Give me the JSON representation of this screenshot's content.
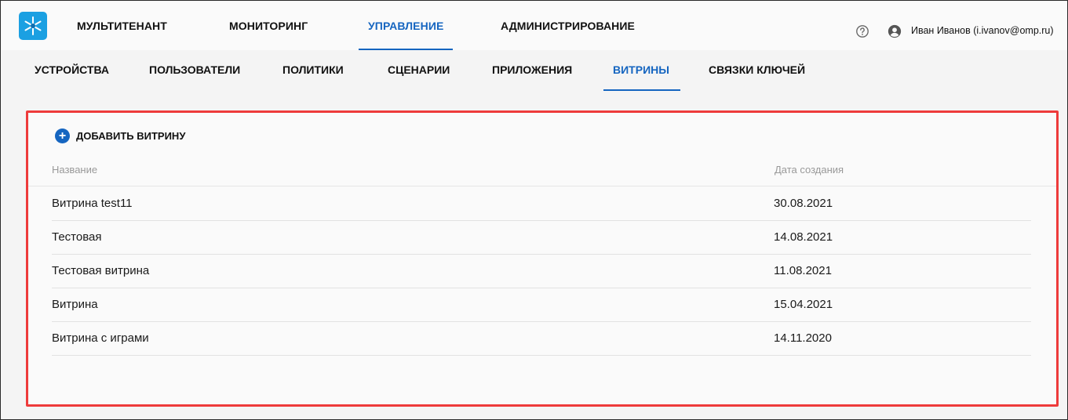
{
  "top_nav": {
    "items": [
      "МУЛЬТИТЕНАНТ",
      "МОНИТОРИНГ",
      "УПРАВЛЕНИЕ",
      "АДМИНИСТРИРОВАНИЕ"
    ],
    "active": "УПРАВЛЕНИЕ"
  },
  "user": {
    "name": "Иван Иванов (i.ivanov@omp.ru)"
  },
  "sub_nav": {
    "items": [
      "УСТРОЙСТВА",
      "ПОЛЬЗОВАТЕЛИ",
      "ПОЛИТИКИ",
      "СЦЕНАРИИ",
      "ПРИЛОЖЕНИЯ",
      "ВИТРИНЫ",
      "СВЯЗКИ КЛЮЧЕЙ"
    ],
    "active": "ВИТРИНЫ"
  },
  "storefronts": {
    "add_label": "ДОБАВИТЬ ВИТРИНУ",
    "columns": {
      "name": "Название",
      "created": "Дата создания"
    },
    "rows": [
      {
        "name": "Витрина test11",
        "created": "30.08.2021"
      },
      {
        "name": "Тестовая",
        "created": "14.08.2021"
      },
      {
        "name": "Тестовая витрина",
        "created": "11.08.2021"
      },
      {
        "name": "Витрина",
        "created": "15.04.2021"
      },
      {
        "name": "Витрина с играми",
        "created": "14.11.2020"
      }
    ]
  },
  "colors": {
    "accent": "#1565c0",
    "highlight_border": "#ee3b3b",
    "logo": "#1ba0e2"
  },
  "icons": {
    "logo": "snowflake-logo",
    "help": "help-circle-icon",
    "user": "account-circle-icon",
    "add": "plus-circle-icon"
  }
}
